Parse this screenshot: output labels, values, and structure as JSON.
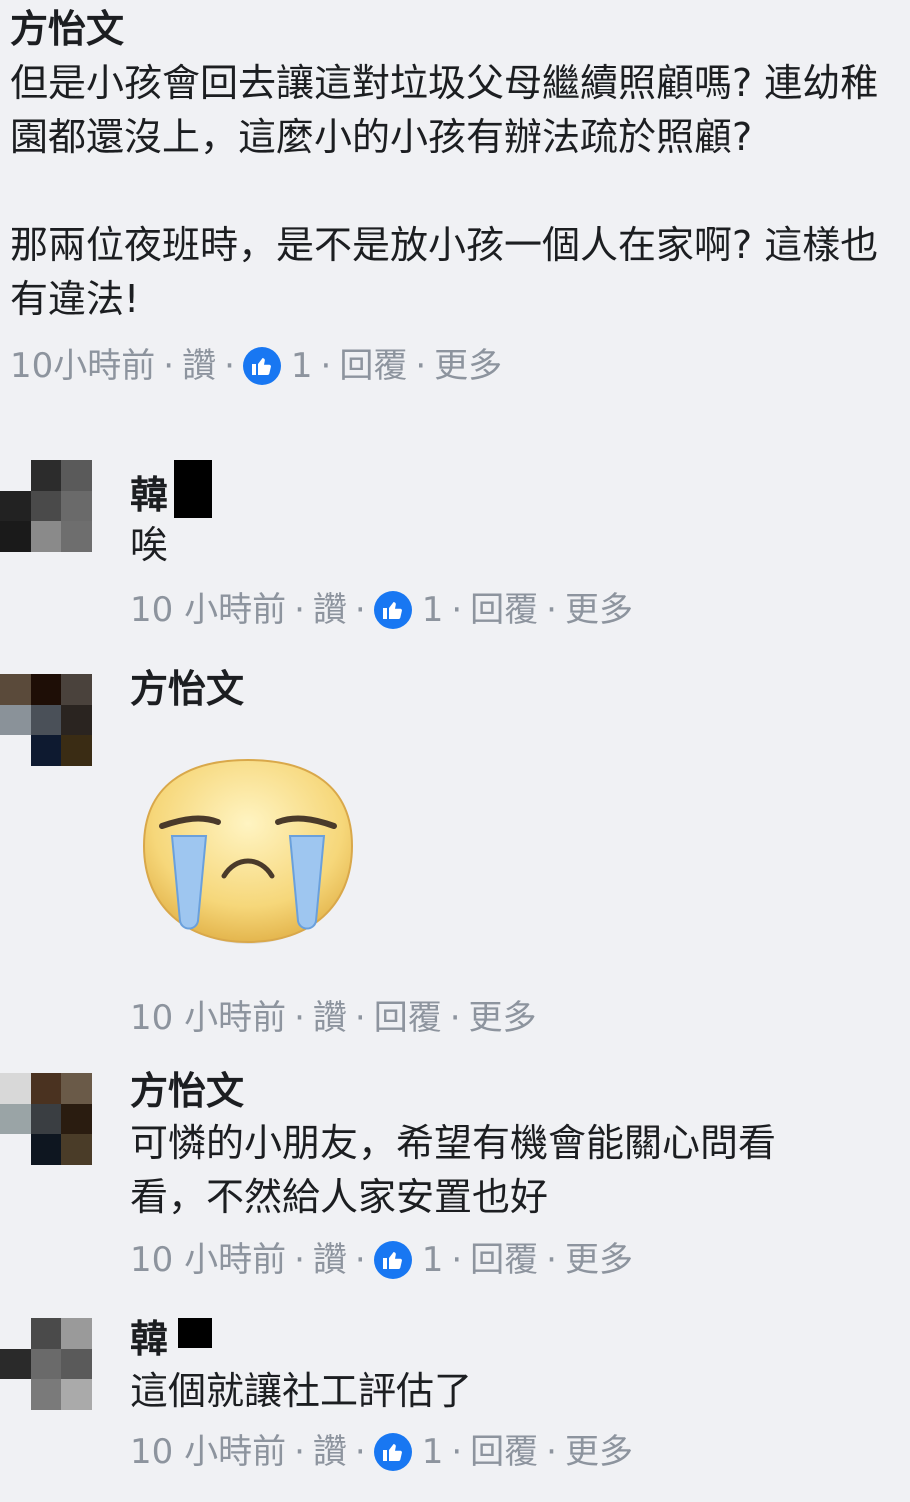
{
  "colors": {
    "background": "#f0f1f4",
    "text": "#1c1e21",
    "meta": "#8d949e",
    "like_blue": "#1877f2"
  },
  "comments": [
    {
      "author": "方怡文",
      "paragraphs": [
        "但是小孩會回去讓這對垃圾父母繼續照顧嗎? 連幼稚園都還沒上，這麼小的小孩有辦法疏於照顧?",
        "那兩位夜班時，是不是放小孩一個人在家啊? 這樣也有違法!"
      ],
      "time": "10小時前",
      "like_label": "讚",
      "likes": "1",
      "reply_label": "回覆",
      "more_label": "更多"
    },
    {
      "author": "韓",
      "text": "唉",
      "time": "10 小時前",
      "like_label": "讚",
      "likes": "1",
      "reply_label": "回覆",
      "more_label": "更多"
    },
    {
      "author": "方怡文",
      "sticker": "crying-face-sticker",
      "time": "10 小時前",
      "like_label": "讚",
      "reply_label": "回覆",
      "more_label": "更多"
    },
    {
      "author": "方怡文",
      "text": "可憐的小朋友，希望有機會能關心問看看，不然給人家安置也好",
      "time": "10 小時前",
      "like_label": "讚",
      "likes": "1",
      "reply_label": "回覆",
      "more_label": "更多"
    },
    {
      "author": "韓",
      "text": "這個就讓社工評估了",
      "time": "10 小時前",
      "like_label": "讚",
      "likes": "1",
      "reply_label": "回覆",
      "more_label": "更多"
    }
  ],
  "separator": "·",
  "icons": {
    "like": "thumbs-up-icon"
  }
}
